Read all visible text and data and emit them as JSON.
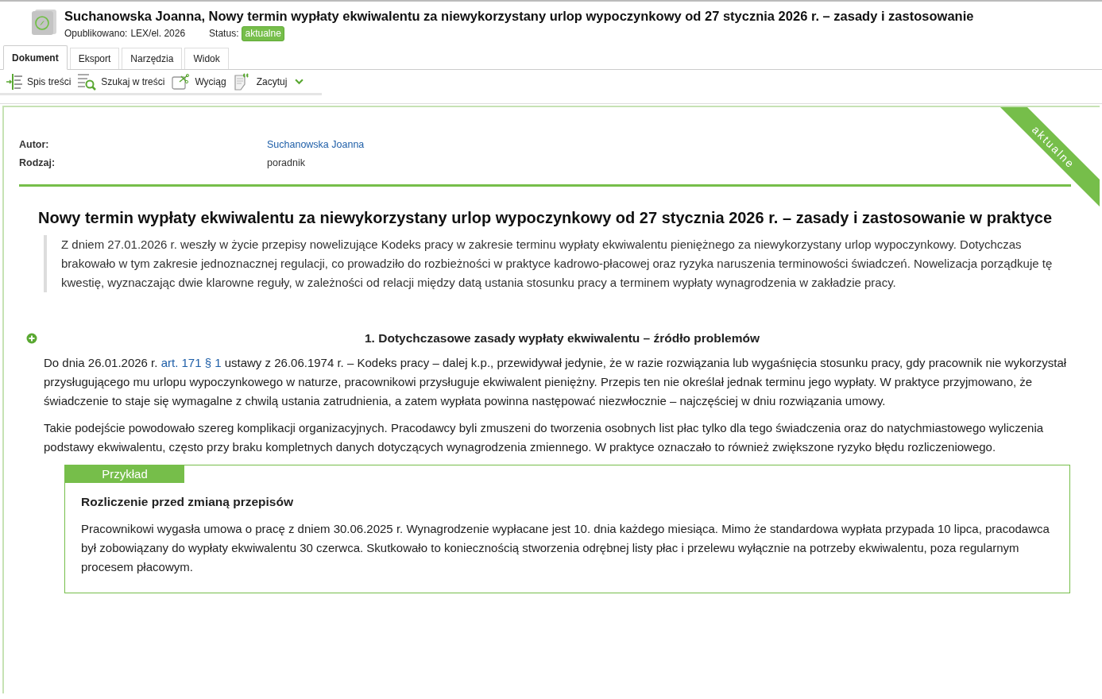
{
  "header": {
    "title": "Suchanowska Joanna, Nowy termin wypłaty ekwiwalentu za niewykorzystany urlop wypoczynkowy od 27 stycznia 2026 r. – zasady i zastosowanie",
    "published_label": "Opublikowano:",
    "published": "LEX/el. 2026",
    "status_label": "Status:",
    "status": "aktualne"
  },
  "tabs": [
    {
      "label": "Dokument",
      "selected": true
    },
    {
      "label": "Eksport",
      "selected": false
    },
    {
      "label": "Narzędzia",
      "selected": false
    },
    {
      "label": "Widok",
      "selected": false
    }
  ],
  "toolbar": [
    {
      "kind": "toc",
      "label": "Spis treści"
    },
    {
      "kind": "search",
      "label": "Szukaj w treści"
    },
    {
      "kind": "extract",
      "label": "Wyciąg"
    },
    {
      "kind": "quote",
      "label": "Zacytuj",
      "dropdown": true
    }
  ],
  "ribbon": "aktualne",
  "meta": [
    {
      "label": "Autor:",
      "value": "Suchanowska Joanna",
      "link": true
    },
    {
      "label": "Rodzaj:",
      "value": "poradnik",
      "link": false
    }
  ],
  "doc_title": "Nowy termin wypłaty ekwiwalentu za niewykorzystany urlop wypoczynkowy od 27 stycznia 2026 r. – zasady i zastosowanie w praktyce",
  "lead": "Z dniem 27.01.2026 r. weszły w życie przepisy nowelizujące Kodeks pracy w zakresie terminu wypłaty ekwiwalentu pieniężnego za niewykorzystany urlop wypoczynkowy. Dotychczas brakowało w tym zakresie jednoznacznej regulacji, co prowadziło do rozbieżności w praktyce kadrowo-płacowej oraz ryzyka naruszenia terminowości świadczeń. Nowelizacja porządkuje tę kwestię, wyznaczając dwie klarowne reguły, w zależności od relacji między datą ustania stosunku pracy a terminem wypłaty wynagrodzenia w zakładzie pracy.",
  "section": {
    "heading": "1. Dotychczasowe zasady wypłaty ekwiwalentu – źródło problemów",
    "expanded": false,
    "paragraphs": [
      {
        "before": "Do dnia 26.01.2026 r. ",
        "link": "art. 171 § 1",
        "after": " ustawy z 26.06.1974 r. – Kodeks pracy – dalej k.p., przewidywał jedynie, że w razie rozwiązania lub wygaśnięcia stosunku pracy, gdy pracownik nie wykorzystał przysługującego mu urlopu wypoczynkowego w naturze, pracownikowi przysługuje ekwiwalent pieniężny. Przepis ten nie określał jednak terminu jego wypłaty. W praktyce przyjmowano, że świadczenie to staje się wymagalne z chwilą ustania zatrudnienia, a zatem wypłata powinna następować niezwłocznie – najczęściej w dniu rozwiązania umowy."
      },
      {
        "before": "Takie podejście powodowało szereg komplikacji organizacyjnych. Pracodawcy byli zmuszeni do tworzenia osobnych list płac tylko dla tego świadczenia oraz do natychmiastowego wyliczenia podstawy ekwiwalentu, często przy braku kompletnych danych dotyczących wynagrodzenia zmiennego. W praktyce oznaczało to również zwiększone ryzyko błędu rozliczeniowego."
      }
    ],
    "example": {
      "tag": "Przykład",
      "title": "Rozliczenie przed zmianą przepisów",
      "text": "Pracownikowi wygasła umowa o pracę z dniem 30.06.2025 r. Wynagrodzenie wypłacane jest 10. dnia każdego miesiąca. Mimo że standardowa wypłata przypada 10 lipca, pracodawca był zobowiązany do wypłaty ekwiwalentu 30 czerwca. Skutkowało to koniecznością stworzenia odrębnej listy płac i przelewu wyłącznie na potrzeby ekwiwalentu, poza regularnym procesem płacowym."
    }
  }
}
